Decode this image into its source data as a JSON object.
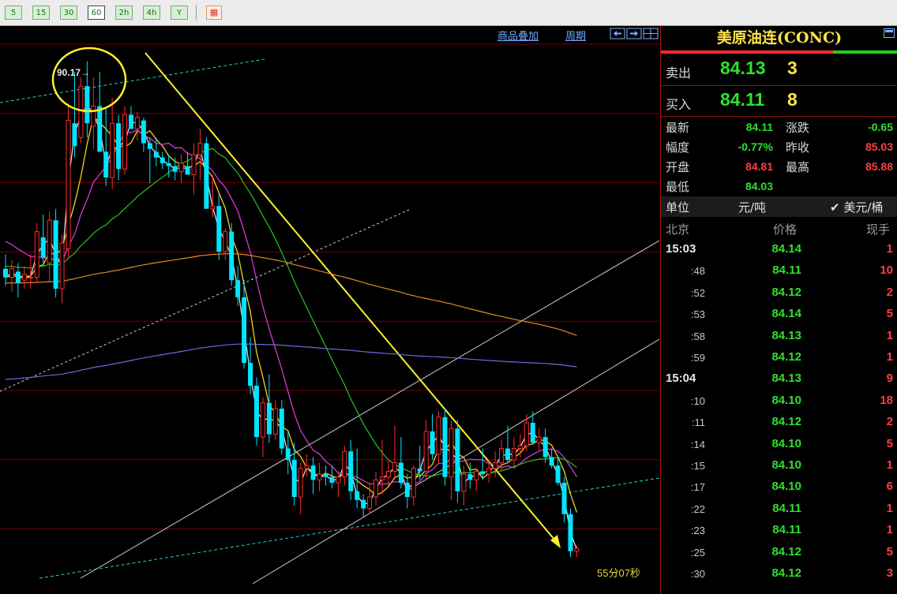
{
  "toolbar": {
    "timeframes": [
      {
        "label": "5",
        "active": false
      },
      {
        "label": "15",
        "active": false
      },
      {
        "label": "30",
        "active": false
      },
      {
        "label": "60",
        "active": true
      },
      {
        "label": "2h",
        "active": false
      },
      {
        "label": "4h",
        "active": false
      },
      {
        "label": "Y",
        "active": false
      }
    ],
    "grid_icon": "grid-icon"
  },
  "chart": {
    "overlay_link": "商品叠加",
    "period_link": "周期",
    "annotation_high": "90.17→",
    "countdown": "55分07秒"
  },
  "chart_data": {
    "type": "candlestick",
    "candles": [
      [
        82.9,
        83.4,
        82.3,
        82.6
      ],
      [
        82.6,
        83.2,
        82.1,
        82.9
      ],
      [
        82.8,
        83.1,
        81.9,
        82.4
      ],
      [
        82.5,
        83.0,
        82.2,
        82.7
      ],
      [
        82.6,
        83.4,
        82.2,
        82.6
      ],
      [
        82.6,
        84.5,
        82.4,
        84.2
      ],
      [
        84.0,
        84.8,
        83.1,
        83.3
      ],
      [
        83.1,
        84.9,
        82.4,
        84.6
      ],
      [
        84.6,
        85.0,
        81.9,
        82.2
      ],
      [
        82.2,
        84.1,
        81.7,
        83.8
      ],
      [
        83.6,
        88.7,
        83.3,
        88.1
      ],
      [
        88.0,
        89.8,
        86.8,
        87.2
      ],
      [
        87.5,
        89.6,
        87.3,
        89.3
      ],
      [
        89.3,
        90.17,
        87.5,
        88.0
      ],
      [
        87.9,
        89.6,
        87.1,
        88.6
      ],
      [
        88.6,
        89.8,
        87.3,
        87.0
      ],
      [
        87.0,
        88.5,
        85.8,
        86.1
      ],
      [
        86.1,
        88.9,
        85.7,
        88.0
      ],
      [
        88.0,
        88.3,
        86.0,
        86.4
      ],
      [
        86.4,
        88.6,
        86.2,
        88.3
      ],
      [
        88.3,
        88.6,
        87.8,
        87.8
      ],
      [
        87.8,
        88.4,
        87.4,
        88.2
      ],
      [
        88.1,
        88.2,
        87.0,
        87.3
      ],
      [
        87.3,
        87.5,
        85.9,
        87.1
      ],
      [
        87.0,
        87.5,
        86.5,
        86.8
      ],
      [
        86.8,
        87.0,
        86.4,
        86.6
      ],
      [
        86.6,
        86.9,
        86.1,
        86.5
      ],
      [
        86.5,
        86.8,
        86.0,
        86.3
      ],
      [
        86.3,
        86.9,
        85.9,
        86.6
      ],
      [
        86.5,
        87.0,
        86.2,
        86.2
      ],
      [
        86.2,
        87.3,
        85.5,
        86.9
      ],
      [
        86.9,
        87.8,
        86.0,
        87.3
      ],
      [
        87.3,
        87.5,
        85.3,
        85.0
      ],
      [
        85.0,
        86.2,
        84.7,
        85.1
      ],
      [
        85.1,
        85.5,
        83.2,
        83.5
      ],
      [
        83.5,
        84.3,
        83.2,
        84.2
      ],
      [
        84.2,
        84.5,
        82.3,
        82.5
      ],
      [
        82.5,
        83.0,
        81.6,
        81.9
      ],
      [
        81.9,
        82.5,
        79.4,
        79.6
      ],
      [
        79.6,
        80.5,
        78.5,
        78.8
      ],
      [
        78.8,
        79.1,
        76.7,
        77.0
      ],
      [
        77.0,
        78.4,
        76.3,
        78.2
      ],
      [
        78.2,
        79.2,
        76.8,
        77.1
      ],
      [
        77.1,
        78.3,
        76.9,
        78.0
      ],
      [
        78.0,
        78.3,
        76.4,
        76.6
      ],
      [
        76.6,
        77.2,
        75.7,
        76.2
      ],
      [
        76.2,
        76.8,
        74.6,
        74.9
      ],
      [
        74.9,
        76.1,
        74.3,
        75.9
      ],
      [
        75.9,
        76.4,
        75.6,
        76.0
      ],
      [
        76.0,
        76.3,
        75.0,
        75.5
      ],
      [
        75.5,
        76.1,
        75.1,
        75.7
      ],
      [
        75.7,
        76.0,
        75.3,
        75.6
      ],
      [
        75.6,
        76.0,
        75.2,
        75.4
      ],
      [
        75.4,
        75.8,
        74.9,
        75.6
      ],
      [
        75.6,
        76.7,
        75.3,
        76.5
      ],
      [
        76.5,
        76.9,
        74.8,
        75.1
      ],
      [
        75.1,
        76.6,
        74.5,
        74.8
      ],
      [
        74.8,
        75.0,
        74.2,
        74.5
      ],
      [
        74.5,
        75.4,
        74.3,
        74.9
      ],
      [
        74.9,
        75.8,
        74.6,
        75.5
      ],
      [
        75.5,
        76.9,
        75.0,
        75.6
      ],
      [
        75.6,
        76.2,
        75.3,
        75.8
      ],
      [
        75.8,
        77.4,
        75.6,
        76.1
      ],
      [
        76.1,
        77.0,
        75.2,
        75.4
      ],
      [
        75.4,
        75.7,
        74.5,
        74.9
      ],
      [
        74.9,
        76.0,
        74.6,
        75.9
      ],
      [
        75.9,
        76.7,
        75.5,
        75.8
      ],
      [
        75.8,
        77.6,
        75.5,
        77.2
      ],
      [
        77.2,
        77.8,
        76.2,
        76.4
      ],
      [
        76.4,
        77.9,
        76.1,
        77.7
      ],
      [
        77.7,
        78.0,
        75.3,
        75.6
      ],
      [
        75.6,
        77.6,
        74.8,
        77.3
      ],
      [
        77.3,
        77.6,
        74.7,
        75.1
      ],
      [
        75.1,
        76.0,
        74.6,
        75.7
      ],
      [
        75.7,
        76.1,
        75.2,
        75.5
      ],
      [
        75.5,
        75.9,
        75.1,
        75.8
      ],
      [
        75.8,
        76.6,
        75.5,
        75.7
      ],
      [
        75.7,
        76.2,
        75.4,
        75.9
      ],
      [
        75.9,
        76.5,
        75.6,
        76.1
      ],
      [
        76.1,
        76.9,
        75.8,
        76.6
      ],
      [
        76.6,
        77.4,
        76.1,
        76.2
      ],
      [
        76.2,
        77.0,
        76.0,
        76.6
      ],
      [
        76.6,
        77.1,
        76.3,
        76.7
      ],
      [
        76.7,
        77.8,
        76.5,
        77.5
      ],
      [
        77.5,
        77.9,
        76.9,
        76.8
      ],
      [
        76.8,
        77.3,
        76.5,
        77.0
      ],
      [
        77.0,
        77.3,
        76.1,
        76.3
      ],
      [
        76.3,
        76.6,
        75.9,
        76.0
      ],
      [
        76.0,
        76.3,
        75.3,
        75.4
      ],
      [
        75.4,
        75.6,
        74.0,
        74.3
      ],
      [
        74.3,
        74.5,
        72.8,
        73.0
      ],
      [
        73.0,
        73.2,
        72.8,
        73.1
      ]
    ],
    "price_range": [
      71.5,
      90.8
    ]
  },
  "panel": {
    "title": "美原油连(CONC)",
    "sell_label": "卖出",
    "sell_price": "84.13",
    "sell_vol": "3",
    "buy_label": "买入",
    "buy_price": "84.11",
    "buy_vol": "8",
    "stats": [
      {
        "label": "最新",
        "value": "84.11",
        "color": "#2fe02f"
      },
      {
        "label": "涨跌",
        "value": "-0.65",
        "color": "#2fe02f"
      },
      {
        "label": "幅度",
        "value": "-0.77%",
        "color": "#2fe02f"
      },
      {
        "label": "昨收",
        "value": "85.03",
        "color": "#ff4040"
      },
      {
        "label": "开盘",
        "value": "84.81",
        "color": "#ff4040"
      },
      {
        "label": "最高",
        "value": "85.88",
        "color": "#ff4040"
      },
      {
        "label": "最低",
        "value": "84.03",
        "color": "#2fe02f"
      }
    ],
    "unit_label": "单位",
    "unit_rmb": "元/吨",
    "unit_usd": "✔ 美元/桶",
    "ticks_header": {
      "time": "北京",
      "price": "价格",
      "vol": "现手"
    },
    "ticks": [
      {
        "time": "15:03",
        "major": true,
        "price": "84.14",
        "vol": "1"
      },
      {
        "time": ":48",
        "major": false,
        "price": "84.11",
        "vol": "10"
      },
      {
        "time": ":52",
        "major": false,
        "price": "84.12",
        "vol": "2"
      },
      {
        "time": ":53",
        "major": false,
        "price": "84.14",
        "vol": "5"
      },
      {
        "time": ":58",
        "major": false,
        "price": "84.13",
        "vol": "1"
      },
      {
        "time": ":59",
        "major": false,
        "price": "84.12",
        "vol": "1"
      },
      {
        "time": "15:04",
        "major": true,
        "price": "84.13",
        "vol": "9"
      },
      {
        "time": ":10",
        "major": false,
        "price": "84.10",
        "vol": "18"
      },
      {
        "time": ":11",
        "major": false,
        "price": "84.12",
        "vol": "2"
      },
      {
        "time": ":14",
        "major": false,
        "price": "84.10",
        "vol": "5"
      },
      {
        "time": ":15",
        "major": false,
        "price": "84.10",
        "vol": "1"
      },
      {
        "time": ":17",
        "major": false,
        "price": "84.10",
        "vol": "6"
      },
      {
        "time": ":22",
        "major": false,
        "price": "84.11",
        "vol": "1"
      },
      {
        "time": ":23",
        "major": false,
        "price": "84.11",
        "vol": "1"
      },
      {
        "time": ":25",
        "major": false,
        "price": "84.12",
        "vol": "5"
      },
      {
        "time": ":30",
        "major": false,
        "price": "84.12",
        "vol": "3"
      }
    ]
  },
  "colors": {
    "bull": "#ff2a2a",
    "bear": "#00e5ff",
    "ma_white": "#dcdcdc",
    "ma_yellow": "#f2d21f",
    "ma_magenta": "#d23ad2",
    "ma_green": "#22c522",
    "ma_orange": "#e08a1e",
    "ma_purple": "#6a6ae0"
  }
}
